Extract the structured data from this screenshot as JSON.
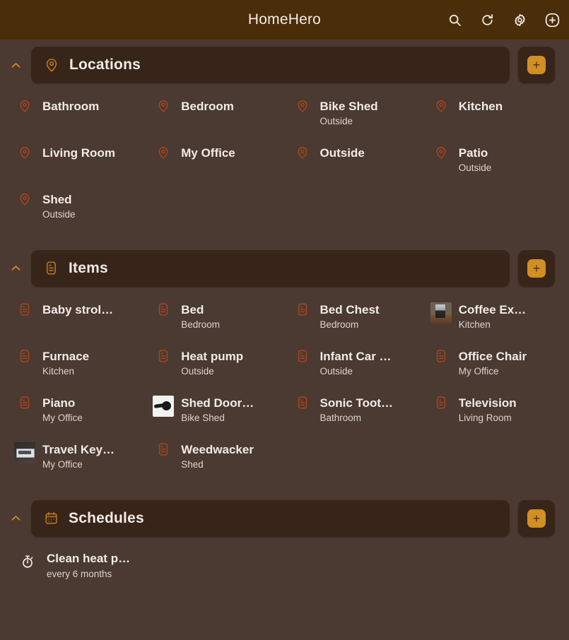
{
  "appbar": {
    "title": "HomeHero",
    "actions": [
      {
        "name": "search-icon",
        "label": "Search"
      },
      {
        "name": "refresh-icon",
        "label": "Refresh"
      },
      {
        "name": "gear-icon",
        "label": "Settings"
      },
      {
        "name": "add-circle-icon",
        "label": "Add"
      }
    ]
  },
  "colors": {
    "appbar_bg": "#4a2d09",
    "page_bg": "#4a3a32",
    "pill_bg": "#38251a",
    "accent": "#d28f22",
    "icon_accent": "#a8441b",
    "text": "#f2ece8",
    "subtext": "#ddd4ce"
  },
  "sections": {
    "locations": {
      "title": "Locations",
      "icon": "map-pin-icon",
      "collapse_label": "⌃",
      "add_label": "+",
      "items": [
        {
          "name": "Bathroom",
          "sub": ""
        },
        {
          "name": "Bedroom",
          "sub": ""
        },
        {
          "name": "Bike Shed",
          "sub": "Outside"
        },
        {
          "name": "Kitchen",
          "sub": ""
        },
        {
          "name": "Living Room",
          "sub": ""
        },
        {
          "name": "My Office",
          "sub": ""
        },
        {
          "name": "Outside",
          "sub": ""
        },
        {
          "name": "Patio",
          "sub": "Outside"
        },
        {
          "name": "Shed",
          "sub": "Outside"
        }
      ]
    },
    "items": {
      "title": "Items",
      "icon": "item-doc-icon",
      "collapse_label": "⌃",
      "add_label": "+",
      "items": [
        {
          "name": "Baby strol…",
          "sub": "",
          "thumb": "doc"
        },
        {
          "name": "Bed",
          "sub": "Bedroom",
          "thumb": "doc"
        },
        {
          "name": "Bed Chest",
          "sub": "Bedroom",
          "thumb": "doc"
        },
        {
          "name": "Coffee Ex…",
          "sub": "Kitchen",
          "thumb": "photo-coffee"
        },
        {
          "name": "Furnace",
          "sub": "Kitchen",
          "thumb": "doc"
        },
        {
          "name": "Heat pump",
          "sub": "Outside",
          "thumb": "doc"
        },
        {
          "name": "Infant Car …",
          "sub": "Outside",
          "thumb": "doc"
        },
        {
          "name": "Office Chair",
          "sub": "My Office",
          "thumb": "doc"
        },
        {
          "name": "Piano",
          "sub": "My Office",
          "thumb": "doc"
        },
        {
          "name": "Shed Door…",
          "sub": "Bike Shed",
          "thumb": "photo-handle"
        },
        {
          "name": "Sonic Toot…",
          "sub": "Bathroom",
          "thumb": "doc"
        },
        {
          "name": "Television",
          "sub": "Living Room",
          "thumb": "doc"
        },
        {
          "name": "Travel Key…",
          "sub": "My Office",
          "thumb": "photo-keyboard"
        },
        {
          "name": "Weedwacker",
          "sub": "Shed",
          "thumb": "doc"
        }
      ]
    },
    "schedules": {
      "title": "Schedules",
      "icon": "calendar-icon",
      "collapse_label": "⌃",
      "add_label": "+",
      "items": [
        {
          "name": "Clean heat p…",
          "sub": "every 6 months",
          "icon": "stopwatch-icon"
        }
      ]
    }
  }
}
